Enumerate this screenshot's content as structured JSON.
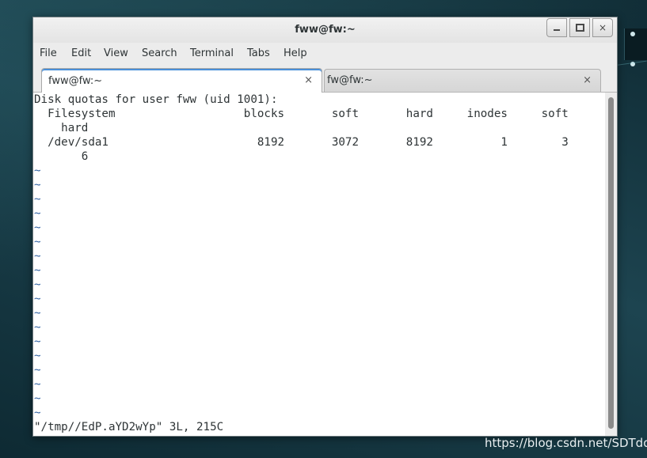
{
  "window": {
    "title": "fww@fw:~"
  },
  "window_buttons": {
    "minimize": "minimize-icon",
    "maximize": "maximize-icon",
    "close": "close-icon",
    "close_glyph": "×"
  },
  "menubar": {
    "items": [
      {
        "label": "File"
      },
      {
        "label": "Edit"
      },
      {
        "label": "View"
      },
      {
        "label": "Search"
      },
      {
        "label": "Terminal"
      },
      {
        "label": "Tabs"
      },
      {
        "label": "Help"
      }
    ]
  },
  "tabs": [
    {
      "label": "fww@fw:~",
      "close": "×",
      "active": true
    },
    {
      "label": "fw@fw:~",
      "close": "×",
      "active": false
    }
  ],
  "terminal": {
    "lines": [
      "Disk quotas for user fww (uid 1001):",
      "  Filesystem                   blocks       soft       hard     inodes     soft",
      "    hard",
      "  /dev/sda1                      8192       3072       8192          1        3",
      "       6"
    ],
    "tilde": "~",
    "tilde_count": 18,
    "status_line": "\"/tmp//EdP.aYD2wYp\" 3L, 215C"
  },
  "colors": {
    "accent": "#4a90d9",
    "tilde": "#3465a4"
  },
  "watermark": "https://blog.csdn.net/SDTdd"
}
